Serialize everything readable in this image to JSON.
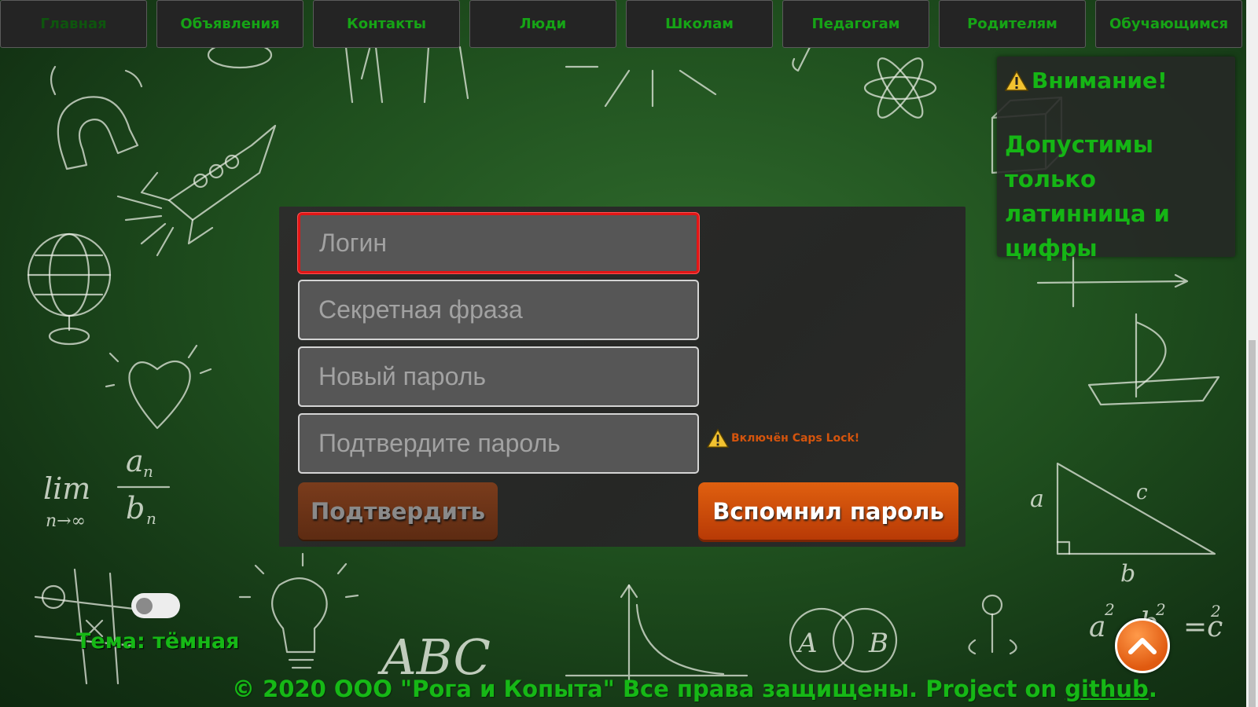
{
  "nav": {
    "items": [
      {
        "label": "Главная",
        "active": true
      },
      {
        "label": "Объявления"
      },
      {
        "label": "Контакты"
      },
      {
        "label": "Люди"
      },
      {
        "label": "Школам"
      },
      {
        "label": "Педагогам"
      },
      {
        "label": "Родителям"
      },
      {
        "label": "Обучающимся"
      }
    ]
  },
  "attention": {
    "title": "Внимание!",
    "body": "Допустимы только латинница и цифры",
    "icon": "warning-icon"
  },
  "form": {
    "login_placeholder": "Логин",
    "secret_placeholder": "Секретная фраза",
    "new_password_placeholder": "Новый пароль",
    "confirm_password_placeholder": "Подтвердите пароль",
    "caps_lock_warning": "Включён Caps Lock!",
    "submit_label": "Подтвердить",
    "remember_label": "Вспомнил пароль"
  },
  "theme": {
    "label": "Тема: тёмная"
  },
  "footer": {
    "text": "© 2020 ООО \"Рога и Копыта\" Все права защищены. Project on ",
    "link": "github",
    "suffix": "."
  },
  "doodles": {
    "abc": "ABC",
    "lim": "lim",
    "lim_sub": "n→∞"
  },
  "colors": {
    "accent_green": "#16b816",
    "orange": "#d4540d",
    "error_red": "#e11616",
    "panel_bg": "#2a2b29"
  }
}
